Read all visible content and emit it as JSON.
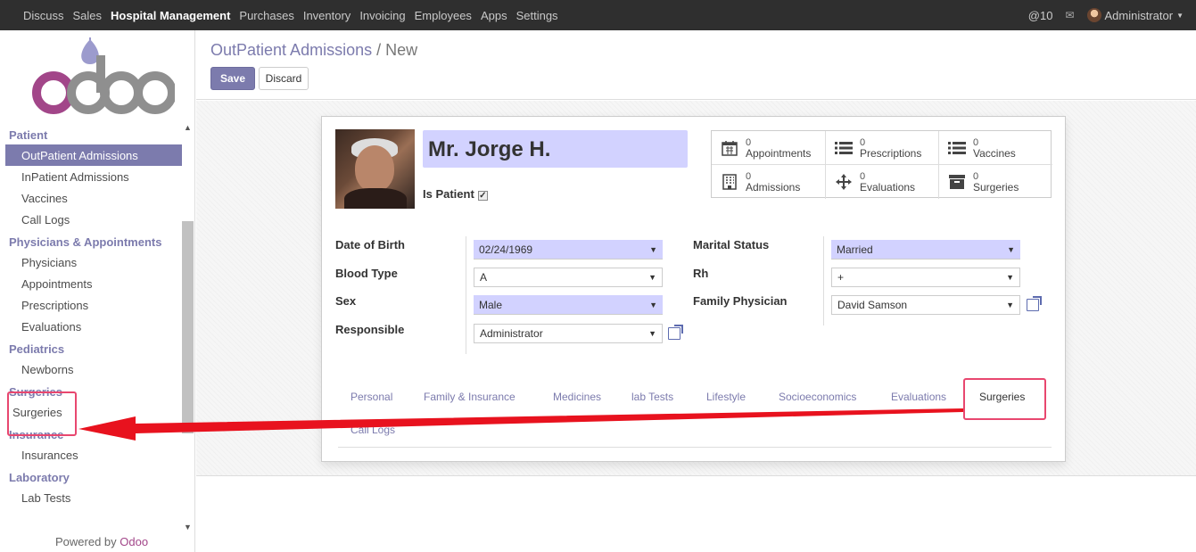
{
  "topbar": {
    "menu": [
      "Discuss",
      "Sales",
      "Hospital Management",
      "Purchases",
      "Inventory",
      "Invoicing",
      "Employees",
      "Apps",
      "Settings"
    ],
    "active_menu": "Hospital Management",
    "mentions": "@10",
    "user": "Administrator"
  },
  "sidebar": {
    "logo_text": "odoo",
    "sections": [
      {
        "title": "Patient",
        "items": [
          "OutPatient Admissions",
          "InPatient Admissions",
          "Vaccines",
          "Call Logs"
        ]
      },
      {
        "title": "Physicians & Appointments",
        "items": [
          "Physicians",
          "Appointments",
          "Prescriptions",
          "Evaluations"
        ]
      },
      {
        "title": "Pediatrics",
        "items": [
          "Newborns"
        ]
      },
      {
        "title": "Surgeries",
        "items": [
          "Surgeries"
        ]
      },
      {
        "title": "Insurance",
        "items": [
          "Insurances"
        ]
      },
      {
        "title": "Laboratory",
        "items": [
          "Lab Tests"
        ]
      }
    ],
    "active_item": "OutPatient Admissions",
    "powered_prefix": "Powered by",
    "powered_brand": "Odoo"
  },
  "control_panel": {
    "breadcrumb_parent": "OutPatient Admissions",
    "breadcrumb_sep": "/",
    "breadcrumb_current": "New",
    "save_label": "Save",
    "discard_label": "Discard"
  },
  "form": {
    "name": "Mr. Jorge H.",
    "is_patient_label": "Is Patient",
    "is_patient_checked": true,
    "stats": [
      {
        "count": "0",
        "label": "Appointments",
        "icon": "calendar-icon"
      },
      {
        "count": "0",
        "label": "Prescriptions",
        "icon": "list-icon"
      },
      {
        "count": "0",
        "label": "Vaccines",
        "icon": "list-icon"
      },
      {
        "count": "0",
        "label": "Admissions",
        "icon": "building-icon"
      },
      {
        "count": "0",
        "label": "Evaluations",
        "icon": "move-icon"
      },
      {
        "count": "0",
        "label": "Surgeries",
        "icon": "archive-icon"
      }
    ],
    "fields": {
      "dob_label": "Date of Birth",
      "dob_value": "02/24/1969",
      "blood_label": "Blood Type",
      "blood_value": "A",
      "sex_label": "Sex",
      "sex_value": "Male",
      "responsible_label": "Responsible",
      "responsible_value": "Administrator",
      "marital_label": "Marital Status",
      "marital_value": "Married",
      "rh_label": "Rh",
      "rh_value": "+",
      "physician_label": "Family Physician",
      "physician_value": "David Samson"
    },
    "tabs": [
      "Personal",
      "Family & Insurance",
      "Medicines",
      "lab Tests",
      "Lifestyle",
      "Socioeconomics",
      "Evaluations",
      "Surgeries",
      "Call Logs"
    ],
    "active_tab": "Surgeries"
  },
  "colors": {
    "accent": "#7c7bad",
    "highlight": "#e8476f",
    "arrow": "#e8121e",
    "required_bg": "#d2d2ff"
  }
}
